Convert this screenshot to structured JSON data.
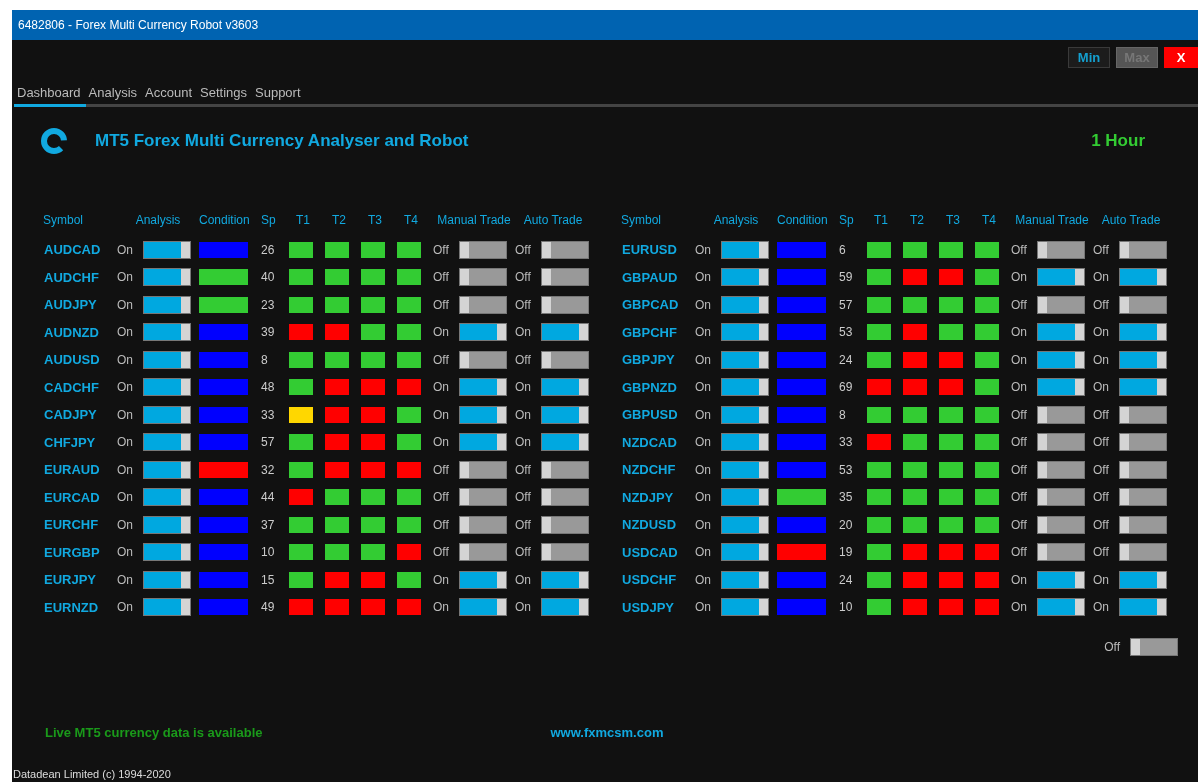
{
  "window": {
    "title": "6482806 - Forex Multi Currency Robot v3603"
  },
  "window_buttons": [
    {
      "label": "Min",
      "kind": "min",
      "disabled": false
    },
    {
      "label": "Max",
      "kind": "max",
      "disabled": true
    },
    {
      "label": "X",
      "kind": "close",
      "disabled": false
    }
  ],
  "tabs": [
    {
      "label": "Dashboard",
      "selected": true
    },
    {
      "label": "Analysis",
      "selected": false
    },
    {
      "label": "Account",
      "selected": false
    },
    {
      "label": "Settings",
      "selected": false
    },
    {
      "label": "Support",
      "selected": false
    }
  ],
  "header": {
    "title": "MT5 Forex Multi Currency Analyser and Robot",
    "timeframe": "1 Hour"
  },
  "tables": [
    {
      "columns": [
        "Symbol",
        "Analysis",
        "Condition",
        "Sp",
        "T1",
        "T2",
        "T3",
        "T4",
        "Manual Trade",
        "Auto Trade"
      ],
      "rows": [
        {
          "symbol": "AUDCAD",
          "analysis": {
            "label": "On",
            "on": true
          },
          "condition": {
            "color": "#0000ff"
          },
          "sp": "26",
          "t": [
            {
              "color": "#33cc33"
            },
            {
              "color": "#33cc33"
            },
            {
              "color": "#33cc33"
            },
            {
              "color": "#33cc33"
            }
          ],
          "manual": {
            "label": "Off",
            "on": false
          },
          "auto": {
            "label": "Off",
            "on": false
          }
        },
        {
          "symbol": "AUDCHF",
          "analysis": {
            "label": "On",
            "on": true
          },
          "condition": {
            "color": "#33cc33"
          },
          "sp": "40",
          "t": [
            {
              "color": "#33cc33"
            },
            {
              "color": "#33cc33"
            },
            {
              "color": "#33cc33"
            },
            {
              "color": "#33cc33"
            }
          ],
          "manual": {
            "label": "Off",
            "on": false
          },
          "auto": {
            "label": "Off",
            "on": false
          }
        },
        {
          "symbol": "AUDJPY",
          "analysis": {
            "label": "On",
            "on": true
          },
          "condition": {
            "color": "#33cc33"
          },
          "sp": "23",
          "t": [
            {
              "color": "#33cc33"
            },
            {
              "color": "#33cc33"
            },
            {
              "color": "#33cc33"
            },
            {
              "color": "#33cc33"
            }
          ],
          "manual": {
            "label": "Off",
            "on": false
          },
          "auto": {
            "label": "Off",
            "on": false
          }
        },
        {
          "symbol": "AUDNZD",
          "analysis": {
            "label": "On",
            "on": true
          },
          "condition": {
            "color": "#0000ff"
          },
          "sp": "39",
          "t": [
            {
              "color": "#ff0000"
            },
            {
              "color": "#ff0000"
            },
            {
              "color": "#33cc33"
            },
            {
              "color": "#33cc33"
            }
          ],
          "manual": {
            "label": "On",
            "on": true
          },
          "auto": {
            "label": "On",
            "on": true
          }
        },
        {
          "symbol": "AUDUSD",
          "analysis": {
            "label": "On",
            "on": true
          },
          "condition": {
            "color": "#0000ff"
          },
          "sp": "8",
          "t": [
            {
              "color": "#33cc33"
            },
            {
              "color": "#33cc33"
            },
            {
              "color": "#33cc33"
            },
            {
              "color": "#33cc33"
            }
          ],
          "manual": {
            "label": "Off",
            "on": false
          },
          "auto": {
            "label": "Off",
            "on": false
          }
        },
        {
          "symbol": "CADCHF",
          "analysis": {
            "label": "On",
            "on": true
          },
          "condition": {
            "color": "#0000ff"
          },
          "sp": "48",
          "t": [
            {
              "color": "#33cc33"
            },
            {
              "color": "#ff0000"
            },
            {
              "color": "#ff0000"
            },
            {
              "color": "#ff0000"
            }
          ],
          "manual": {
            "label": "On",
            "on": true
          },
          "auto": {
            "label": "On",
            "on": true
          }
        },
        {
          "symbol": "CADJPY",
          "analysis": {
            "label": "On",
            "on": true
          },
          "condition": {
            "color": "#0000ff"
          },
          "sp": "33",
          "t": [
            {
              "color": "#ffd700"
            },
            {
              "color": "#ff0000"
            },
            {
              "color": "#ff0000"
            },
            {
              "color": "#33cc33"
            }
          ],
          "manual": {
            "label": "On",
            "on": true
          },
          "auto": {
            "label": "On",
            "on": true
          }
        },
        {
          "symbol": "CHFJPY",
          "analysis": {
            "label": "On",
            "on": true
          },
          "condition": {
            "color": "#0000ff"
          },
          "sp": "57",
          "t": [
            {
              "color": "#33cc33"
            },
            {
              "color": "#ff0000"
            },
            {
              "color": "#ff0000"
            },
            {
              "color": "#33cc33"
            }
          ],
          "manual": {
            "label": "On",
            "on": true
          },
          "auto": {
            "label": "On",
            "on": true
          }
        },
        {
          "symbol": "EURAUD",
          "analysis": {
            "label": "On",
            "on": true
          },
          "condition": {
            "color": "#ff0000"
          },
          "sp": "32",
          "t": [
            {
              "color": "#33cc33"
            },
            {
              "color": "#ff0000"
            },
            {
              "color": "#ff0000"
            },
            {
              "color": "#ff0000"
            }
          ],
          "manual": {
            "label": "Off",
            "on": false
          },
          "auto": {
            "label": "Off",
            "on": false
          }
        },
        {
          "symbol": "EURCAD",
          "analysis": {
            "label": "On",
            "on": true
          },
          "condition": {
            "color": "#0000ff"
          },
          "sp": "44",
          "t": [
            {
              "color": "#ff0000"
            },
            {
              "color": "#33cc33"
            },
            {
              "color": "#33cc33"
            },
            {
              "color": "#33cc33"
            }
          ],
          "manual": {
            "label": "Off",
            "on": false
          },
          "auto": {
            "label": "Off",
            "on": false
          }
        },
        {
          "symbol": "EURCHF",
          "analysis": {
            "label": "On",
            "on": true
          },
          "condition": {
            "color": "#0000ff"
          },
          "sp": "37",
          "t": [
            {
              "color": "#33cc33"
            },
            {
              "color": "#33cc33"
            },
            {
              "color": "#33cc33"
            },
            {
              "color": "#33cc33"
            }
          ],
          "manual": {
            "label": "Off",
            "on": false
          },
          "auto": {
            "label": "Off",
            "on": false
          }
        },
        {
          "symbol": "EURGBP",
          "analysis": {
            "label": "On",
            "on": true
          },
          "condition": {
            "color": "#0000ff"
          },
          "sp": "10",
          "t": [
            {
              "color": "#33cc33"
            },
            {
              "color": "#33cc33"
            },
            {
              "color": "#33cc33"
            },
            {
              "color": "#ff0000"
            }
          ],
          "manual": {
            "label": "Off",
            "on": false
          },
          "auto": {
            "label": "Off",
            "on": false
          }
        },
        {
          "symbol": "EURJPY",
          "analysis": {
            "label": "On",
            "on": true
          },
          "condition": {
            "color": "#0000ff"
          },
          "sp": "15",
          "t": [
            {
              "color": "#33cc33"
            },
            {
              "color": "#ff0000"
            },
            {
              "color": "#ff0000"
            },
            {
              "color": "#33cc33"
            }
          ],
          "manual": {
            "label": "On",
            "on": true
          },
          "auto": {
            "label": "On",
            "on": true
          }
        },
        {
          "symbol": "EURNZD",
          "analysis": {
            "label": "On",
            "on": true
          },
          "condition": {
            "color": "#0000ff"
          },
          "sp": "49",
          "t": [
            {
              "color": "#ff0000"
            },
            {
              "color": "#ff0000"
            },
            {
              "color": "#ff0000"
            },
            {
              "color": "#ff0000"
            }
          ],
          "manual": {
            "label": "On",
            "on": true
          },
          "auto": {
            "label": "On",
            "on": true
          }
        }
      ]
    },
    {
      "columns": [
        "Symbol",
        "Analysis",
        "Condition",
        "Sp",
        "T1",
        "T2",
        "T3",
        "T4",
        "Manual Trade",
        "Auto Trade"
      ],
      "rows": [
        {
          "symbol": "EURUSD",
          "analysis": {
            "label": "On",
            "on": true
          },
          "condition": {
            "color": "#0000ff"
          },
          "sp": "6",
          "t": [
            {
              "color": "#33cc33"
            },
            {
              "color": "#33cc33"
            },
            {
              "color": "#33cc33"
            },
            {
              "color": "#33cc33"
            }
          ],
          "manual": {
            "label": "Off",
            "on": false
          },
          "auto": {
            "label": "Off",
            "on": false
          }
        },
        {
          "symbol": "GBPAUD",
          "analysis": {
            "label": "On",
            "on": true
          },
          "condition": {
            "color": "#0000ff"
          },
          "sp": "59",
          "t": [
            {
              "color": "#33cc33"
            },
            {
              "color": "#ff0000"
            },
            {
              "color": "#ff0000"
            },
            {
              "color": "#33cc33"
            }
          ],
          "manual": {
            "label": "On",
            "on": true
          },
          "auto": {
            "label": "On",
            "on": true
          }
        },
        {
          "symbol": "GBPCAD",
          "analysis": {
            "label": "On",
            "on": true
          },
          "condition": {
            "color": "#0000ff"
          },
          "sp": "57",
          "t": [
            {
              "color": "#33cc33"
            },
            {
              "color": "#33cc33"
            },
            {
              "color": "#33cc33"
            },
            {
              "color": "#33cc33"
            }
          ],
          "manual": {
            "label": "Off",
            "on": false
          },
          "auto": {
            "label": "Off",
            "on": false
          }
        },
        {
          "symbol": "GBPCHF",
          "analysis": {
            "label": "On",
            "on": true
          },
          "condition": {
            "color": "#0000ff"
          },
          "sp": "53",
          "t": [
            {
              "color": "#33cc33"
            },
            {
              "color": "#ff0000"
            },
            {
              "color": "#33cc33"
            },
            {
              "color": "#33cc33"
            }
          ],
          "manual": {
            "label": "On",
            "on": true
          },
          "auto": {
            "label": "On",
            "on": true
          }
        },
        {
          "symbol": "GBPJPY",
          "analysis": {
            "label": "On",
            "on": true
          },
          "condition": {
            "color": "#0000ff"
          },
          "sp": "24",
          "t": [
            {
              "color": "#33cc33"
            },
            {
              "color": "#ff0000"
            },
            {
              "color": "#ff0000"
            },
            {
              "color": "#33cc33"
            }
          ],
          "manual": {
            "label": "On",
            "on": true
          },
          "auto": {
            "label": "On",
            "on": true
          }
        },
        {
          "symbol": "GBPNZD",
          "analysis": {
            "label": "On",
            "on": true
          },
          "condition": {
            "color": "#0000ff"
          },
          "sp": "69",
          "t": [
            {
              "color": "#ff0000"
            },
            {
              "color": "#ff0000"
            },
            {
              "color": "#ff0000"
            },
            {
              "color": "#33cc33"
            }
          ],
          "manual": {
            "label": "On",
            "on": true
          },
          "auto": {
            "label": "On",
            "on": true
          }
        },
        {
          "symbol": "GBPUSD",
          "analysis": {
            "label": "On",
            "on": true
          },
          "condition": {
            "color": "#0000ff"
          },
          "sp": "8",
          "t": [
            {
              "color": "#33cc33"
            },
            {
              "color": "#33cc33"
            },
            {
              "color": "#33cc33"
            },
            {
              "color": "#33cc33"
            }
          ],
          "manual": {
            "label": "Off",
            "on": false
          },
          "auto": {
            "label": "Off",
            "on": false
          }
        },
        {
          "symbol": "NZDCAD",
          "analysis": {
            "label": "On",
            "on": true
          },
          "condition": {
            "color": "#0000ff"
          },
          "sp": "33",
          "t": [
            {
              "color": "#ff0000"
            },
            {
              "color": "#33cc33"
            },
            {
              "color": "#33cc33"
            },
            {
              "color": "#33cc33"
            }
          ],
          "manual": {
            "label": "Off",
            "on": false
          },
          "auto": {
            "label": "Off",
            "on": false
          }
        },
        {
          "symbol": "NZDCHF",
          "analysis": {
            "label": "On",
            "on": true
          },
          "condition": {
            "color": "#0000ff"
          },
          "sp": "53",
          "t": [
            {
              "color": "#33cc33"
            },
            {
              "color": "#33cc33"
            },
            {
              "color": "#33cc33"
            },
            {
              "color": "#33cc33"
            }
          ],
          "manual": {
            "label": "Off",
            "on": false
          },
          "auto": {
            "label": "Off",
            "on": false
          }
        },
        {
          "symbol": "NZDJPY",
          "analysis": {
            "label": "On",
            "on": true
          },
          "condition": {
            "color": "#33cc33"
          },
          "sp": "35",
          "t": [
            {
              "color": "#33cc33"
            },
            {
              "color": "#33cc33"
            },
            {
              "color": "#33cc33"
            },
            {
              "color": "#33cc33"
            }
          ],
          "manual": {
            "label": "Off",
            "on": false
          },
          "auto": {
            "label": "Off",
            "on": false
          }
        },
        {
          "symbol": "NZDUSD",
          "analysis": {
            "label": "On",
            "on": true
          },
          "condition": {
            "color": "#0000ff"
          },
          "sp": "20",
          "t": [
            {
              "color": "#33cc33"
            },
            {
              "color": "#33cc33"
            },
            {
              "color": "#33cc33"
            },
            {
              "color": "#33cc33"
            }
          ],
          "manual": {
            "label": "Off",
            "on": false
          },
          "auto": {
            "label": "Off",
            "on": false
          }
        },
        {
          "symbol": "USDCAD",
          "analysis": {
            "label": "On",
            "on": true
          },
          "condition": {
            "color": "#ff0000"
          },
          "sp": "19",
          "t": [
            {
              "color": "#33cc33"
            },
            {
              "color": "#ff0000"
            },
            {
              "color": "#ff0000"
            },
            {
              "color": "#ff0000"
            }
          ],
          "manual": {
            "label": "Off",
            "on": false
          },
          "auto": {
            "label": "Off",
            "on": false
          }
        },
        {
          "symbol": "USDCHF",
          "analysis": {
            "label": "On",
            "on": true
          },
          "condition": {
            "color": "#0000ff"
          },
          "sp": "24",
          "t": [
            {
              "color": "#33cc33"
            },
            {
              "color": "#ff0000"
            },
            {
              "color": "#ff0000"
            },
            {
              "color": "#ff0000"
            }
          ],
          "manual": {
            "label": "On",
            "on": true
          },
          "auto": {
            "label": "On",
            "on": true
          }
        },
        {
          "symbol": "USDJPY",
          "analysis": {
            "label": "On",
            "on": true
          },
          "condition": {
            "color": "#0000ff"
          },
          "sp": "10",
          "t": [
            {
              "color": "#33cc33"
            },
            {
              "color": "#ff0000"
            },
            {
              "color": "#ff0000"
            },
            {
              "color": "#ff0000"
            }
          ],
          "manual": {
            "label": "On",
            "on": true
          },
          "auto": {
            "label": "On",
            "on": true
          }
        }
      ]
    }
  ],
  "extra_toggle": {
    "label": "Off",
    "on": false
  },
  "footer": {
    "status": "Live MT5 currency data is available",
    "link": "www.fxmcsm.com",
    "copyright": "Datadean Limited (c) 1994-2020"
  }
}
